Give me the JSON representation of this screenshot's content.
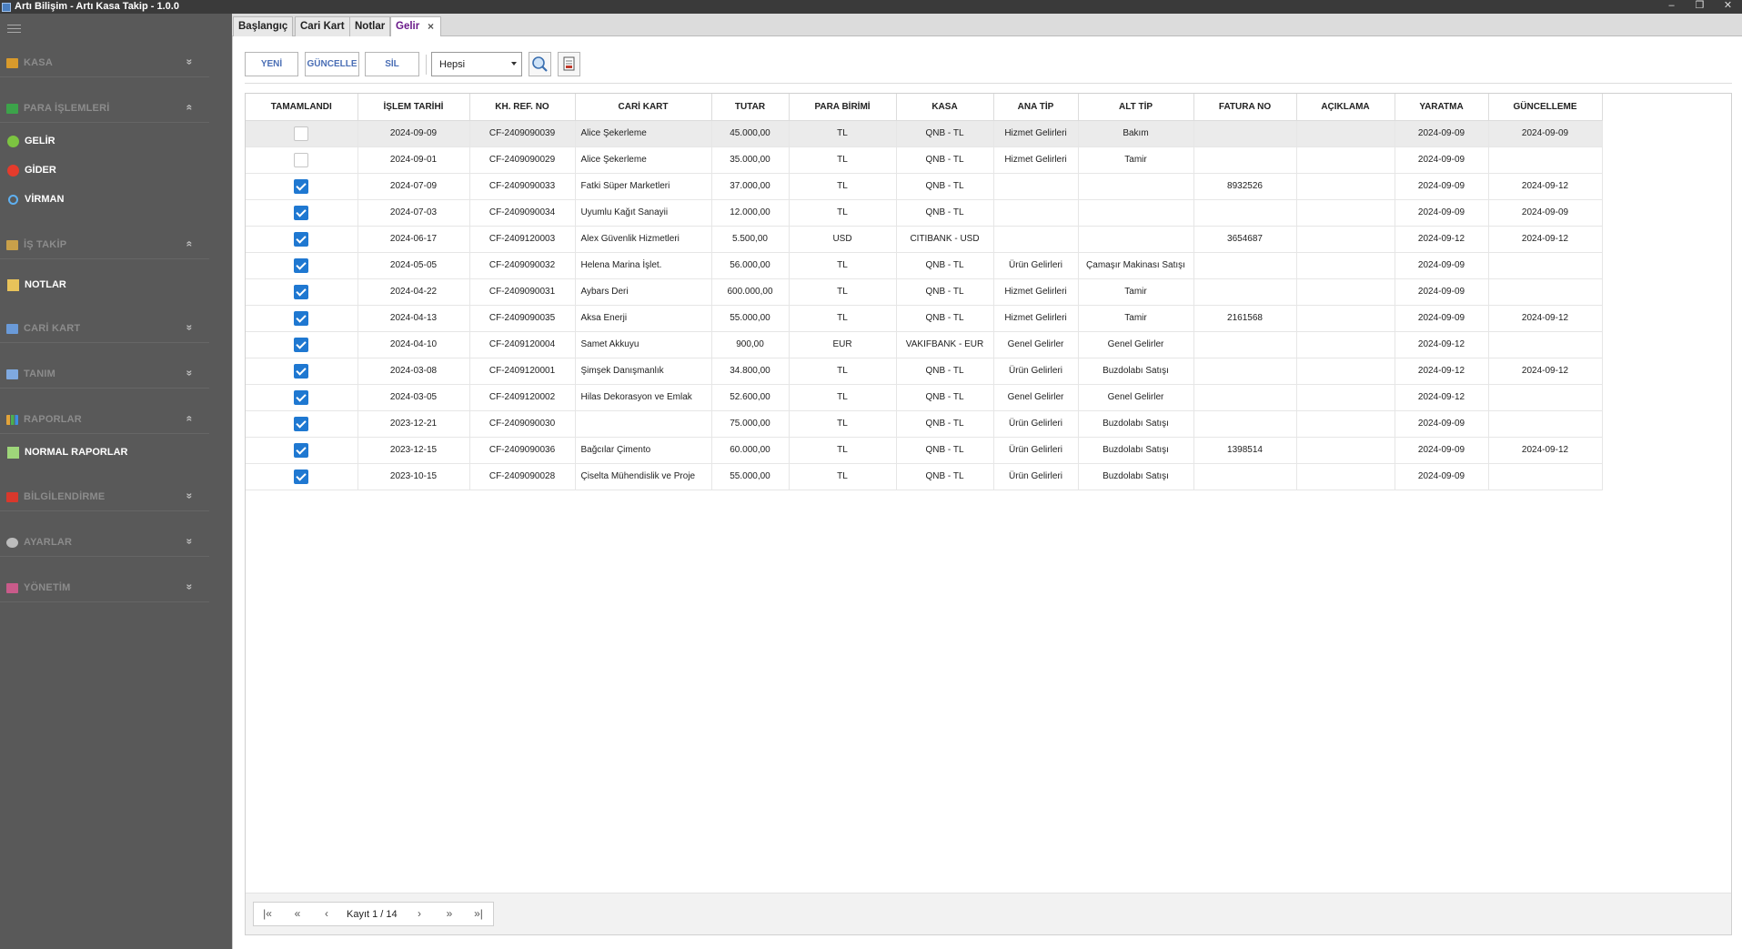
{
  "window": {
    "title": "Artı Bilişim - Artı Kasa Takip - 1.0.0",
    "controls": [
      "–",
      "❐",
      "✕"
    ]
  },
  "sidebar": {
    "groups": [
      {
        "label": "KASA",
        "icon": "cash-register-icon",
        "chevron": "»"
      },
      {
        "label": "PARA İŞLEMLERİ",
        "icon": "money-icon",
        "chevron": "«"
      },
      {
        "label": "İŞ TAKİP",
        "icon": "task-icon",
        "chevron": "«"
      },
      {
        "label": "CARİ KART",
        "icon": "id-card-icon",
        "chevron": "»"
      },
      {
        "label": "TANIM",
        "icon": "list-icon",
        "chevron": "»"
      },
      {
        "label": "RAPORLAR",
        "icon": "bar-chart-icon",
        "chevron": "«"
      },
      {
        "label": "BİLGİLENDİRME",
        "icon": "notification-icon",
        "chevron": "»"
      },
      {
        "label": "AYARLAR",
        "icon": "gear-icon",
        "chevron": "»"
      },
      {
        "label": "YÖNETİM",
        "icon": "admin-icon",
        "chevron": "»"
      }
    ],
    "items": [
      {
        "label": "GELİR",
        "icon": "green-circle-icon"
      },
      {
        "label": "GİDER",
        "icon": "red-circle-icon"
      },
      {
        "label": "VİRMAN",
        "icon": "transfer-icon"
      },
      {
        "label": "NOTLAR",
        "icon": "note-icon"
      },
      {
        "label": "NORMAL RAPORLAR",
        "icon": "report-icon"
      }
    ]
  },
  "tabs": [
    {
      "label": "Başlangıç"
    },
    {
      "label": "Cari Kart"
    },
    {
      "label": "Notlar"
    },
    {
      "label": "Gelir",
      "close": "×"
    }
  ],
  "toolbar": {
    "new_label": "YENİ",
    "update_label": "GÜNCELLE",
    "delete_label": "SİL",
    "filter_value": "Hepsi"
  },
  "grid": {
    "columns": [
      "TAMAMLANDI",
      "İŞLEM TARİHİ",
      "KH. REF. NO",
      "CARİ KART",
      "TUTAR",
      "PARA BİRİMİ",
      "KASA",
      "ANA TİP",
      "ALT TİP",
      "FATURA NO",
      "AÇIKLAMA",
      "YARATMA",
      "GÜNCELLEME"
    ],
    "rows": [
      {
        "done": false,
        "date": "2024-09-09",
        "ref": "CF-2409090039",
        "cari": "Alice Şekerleme",
        "amount": "45.000,00",
        "currency": "TL",
        "kasa": "QNB - TL",
        "ana": "Hizmet Gelirleri",
        "alt": "Bakım",
        "invoice": "",
        "desc": "",
        "created": "2024-09-09",
        "updated": "2024-09-09"
      },
      {
        "done": false,
        "date": "2024-09-01",
        "ref": "CF-2409090029",
        "cari": "Alice Şekerleme",
        "amount": "35.000,00",
        "currency": "TL",
        "kasa": "QNB - TL",
        "ana": "Hizmet Gelirleri",
        "alt": "Tamir",
        "invoice": "",
        "desc": "",
        "created": "2024-09-09",
        "updated": ""
      },
      {
        "done": true,
        "date": "2024-07-09",
        "ref": "CF-2409090033",
        "cari": "Fatki Süper Marketleri",
        "amount": "37.000,00",
        "currency": "TL",
        "kasa": "QNB - TL",
        "ana": "",
        "alt": "",
        "invoice": "8932526",
        "desc": "",
        "created": "2024-09-09",
        "updated": "2024-09-12"
      },
      {
        "done": true,
        "date": "2024-07-03",
        "ref": "CF-2409090034",
        "cari": "Uyumlu Kağıt Sanayii",
        "amount": "12.000,00",
        "currency": "TL",
        "kasa": "QNB - TL",
        "ana": "",
        "alt": "",
        "invoice": "",
        "desc": "",
        "created": "2024-09-09",
        "updated": "2024-09-09"
      },
      {
        "done": true,
        "date": "2024-06-17",
        "ref": "CF-2409120003",
        "cari": "Alex Güvenlik Hizmetleri",
        "amount": "5.500,00",
        "currency": "USD",
        "kasa": "CITIBANK - USD",
        "ana": "",
        "alt": "",
        "invoice": "3654687",
        "desc": "",
        "created": "2024-09-12",
        "updated": "2024-09-12"
      },
      {
        "done": true,
        "date": "2024-05-05",
        "ref": "CF-2409090032",
        "cari": "Helena Marina İşlet.",
        "amount": "56.000,00",
        "currency": "TL",
        "kasa": "QNB - TL",
        "ana": "Ürün Gelirleri",
        "alt": "Çamaşır Makinası Satışı",
        "invoice": "",
        "desc": "",
        "created": "2024-09-09",
        "updated": ""
      },
      {
        "done": true,
        "date": "2024-04-22",
        "ref": "CF-2409090031",
        "cari": "Aybars Deri",
        "amount": "600.000,00",
        "currency": "TL",
        "kasa": "QNB - TL",
        "ana": "Hizmet Gelirleri",
        "alt": "Tamir",
        "invoice": "",
        "desc": "",
        "created": "2024-09-09",
        "updated": ""
      },
      {
        "done": true,
        "date": "2024-04-13",
        "ref": "CF-2409090035",
        "cari": "Aksa Enerji",
        "amount": "55.000,00",
        "currency": "TL",
        "kasa": "QNB - TL",
        "ana": "Hizmet Gelirleri",
        "alt": "Tamir",
        "invoice": "2161568",
        "desc": "",
        "created": "2024-09-09",
        "updated": "2024-09-12"
      },
      {
        "done": true,
        "date": "2024-04-10",
        "ref": "CF-2409120004",
        "cari": "Samet Akkuyu",
        "amount": "900,00",
        "currency": "EUR",
        "kasa": "VAKIFBANK - EUR",
        "ana": "Genel Gelirler",
        "alt": "Genel Gelirler",
        "invoice": "",
        "desc": "",
        "created": "2024-09-12",
        "updated": ""
      },
      {
        "done": true,
        "date": "2024-03-08",
        "ref": "CF-2409120001",
        "cari": "Şimşek Danışmanlık",
        "amount": "34.800,00",
        "currency": "TL",
        "kasa": "QNB - TL",
        "ana": "Ürün Gelirleri",
        "alt": "Buzdolabı Satışı",
        "invoice": "",
        "desc": "",
        "created": "2024-09-12",
        "updated": "2024-09-12"
      },
      {
        "done": true,
        "date": "2024-03-05",
        "ref": "CF-2409120002",
        "cari": "Hilas Dekorasyon ve Emlak",
        "amount": "52.600,00",
        "currency": "TL",
        "kasa": "QNB - TL",
        "ana": "Genel Gelirler",
        "alt": "Genel Gelirler",
        "invoice": "",
        "desc": "",
        "created": "2024-09-12",
        "updated": ""
      },
      {
        "done": true,
        "date": "2023-12-21",
        "ref": "CF-2409090030",
        "cari": "",
        "amount": "75.000,00",
        "currency": "TL",
        "kasa": "QNB - TL",
        "ana": "Ürün Gelirleri",
        "alt": "Buzdolabı Satışı",
        "invoice": "",
        "desc": "",
        "created": "2024-09-09",
        "updated": ""
      },
      {
        "done": true,
        "date": "2023-12-15",
        "ref": "CF-2409090036",
        "cari": "Bağcılar Çimento",
        "amount": "60.000,00",
        "currency": "TL",
        "kasa": "QNB - TL",
        "ana": "Ürün Gelirleri",
        "alt": "Buzdolabı Satışı",
        "invoice": "1398514",
        "desc": "",
        "created": "2024-09-09",
        "updated": "2024-09-12"
      },
      {
        "done": true,
        "date": "2023-10-15",
        "ref": "CF-2409090028",
        "cari": "Çiselta Mühendislik ve Proje",
        "amount": "55.000,00",
        "currency": "TL",
        "kasa": "QNB - TL",
        "ana": "Ürün Gelirleri",
        "alt": "Buzdolabı Satışı",
        "invoice": "",
        "desc": "",
        "created": "2024-09-09",
        "updated": ""
      }
    ]
  },
  "pager": {
    "first": "|«",
    "prev_page": "«",
    "prev": "‹",
    "record_text": "Kayıt 1 / 14",
    "next": "›",
    "next_page": "»",
    "last": "»|"
  },
  "colors": {
    "accent": "#1f78d1",
    "active_tab_text": "#6a1a8a",
    "sidebar_bg": "#595959",
    "button_text": "#4a6eb5"
  }
}
